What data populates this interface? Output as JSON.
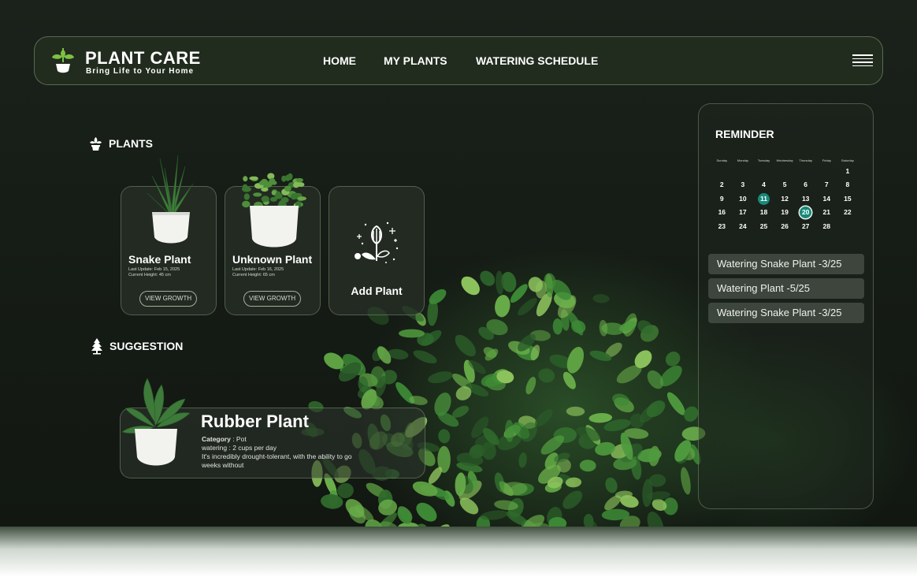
{
  "brand": {
    "title": "PLANT CARE",
    "tagline": "Bring Life to Your Home"
  },
  "nav": {
    "items": [
      "HOME",
      "MY PLANTS",
      "WATERING SCHEDULE"
    ]
  },
  "plants": {
    "heading": "PLANTS",
    "cards": [
      {
        "name": "Snake Plant",
        "last_update": "Last Update: Feb 15, 2025",
        "height": "Current Height: 45 cm",
        "button": "VIEW GROWTH"
      },
      {
        "name": "Unknown Plant",
        "last_update": "Last Update: Feb 16, 2025",
        "height": "Current Height: 65 cm",
        "button": "VIEW GROWTH"
      }
    ],
    "add_label": "Add Plant"
  },
  "suggestion": {
    "heading": "SUGGESTION",
    "name": "Rubber Plant",
    "category_label": "Category",
    "category_value": " : Pot",
    "watering": "watering : 2 cups per day",
    "desc_line1": "It's incredibly drought-tolerant, with the ability to go",
    "desc_line2": "weeks without"
  },
  "reminder": {
    "title": "REMINDER",
    "weekdays": [
      "Sunday",
      "Monday",
      "Tuesday",
      "Wednesday",
      "Thursday",
      "Friday",
      "Saturday"
    ],
    "weeks": [
      [
        "",
        "",
        "",
        "",
        "",
        "",
        "1"
      ],
      [
        "2",
        "3",
        "4",
        "5",
        "6",
        "7",
        "8"
      ],
      [
        "9",
        "10",
        "11",
        "12",
        "13",
        "14",
        "15"
      ],
      [
        "16",
        "17",
        "18",
        "19",
        "20",
        "21",
        "22"
      ],
      [
        "23",
        "24",
        "25",
        "26",
        "27",
        "28",
        ""
      ]
    ],
    "highlighted_days": [
      "11",
      "20"
    ],
    "items": [
      "Watering Snake Plant -3/25",
      "Watering Plant -5/25",
      "Watering Snake Plant -3/25"
    ]
  },
  "colors": {
    "accent": "#17897a",
    "logo_green": "#7dc243"
  }
}
